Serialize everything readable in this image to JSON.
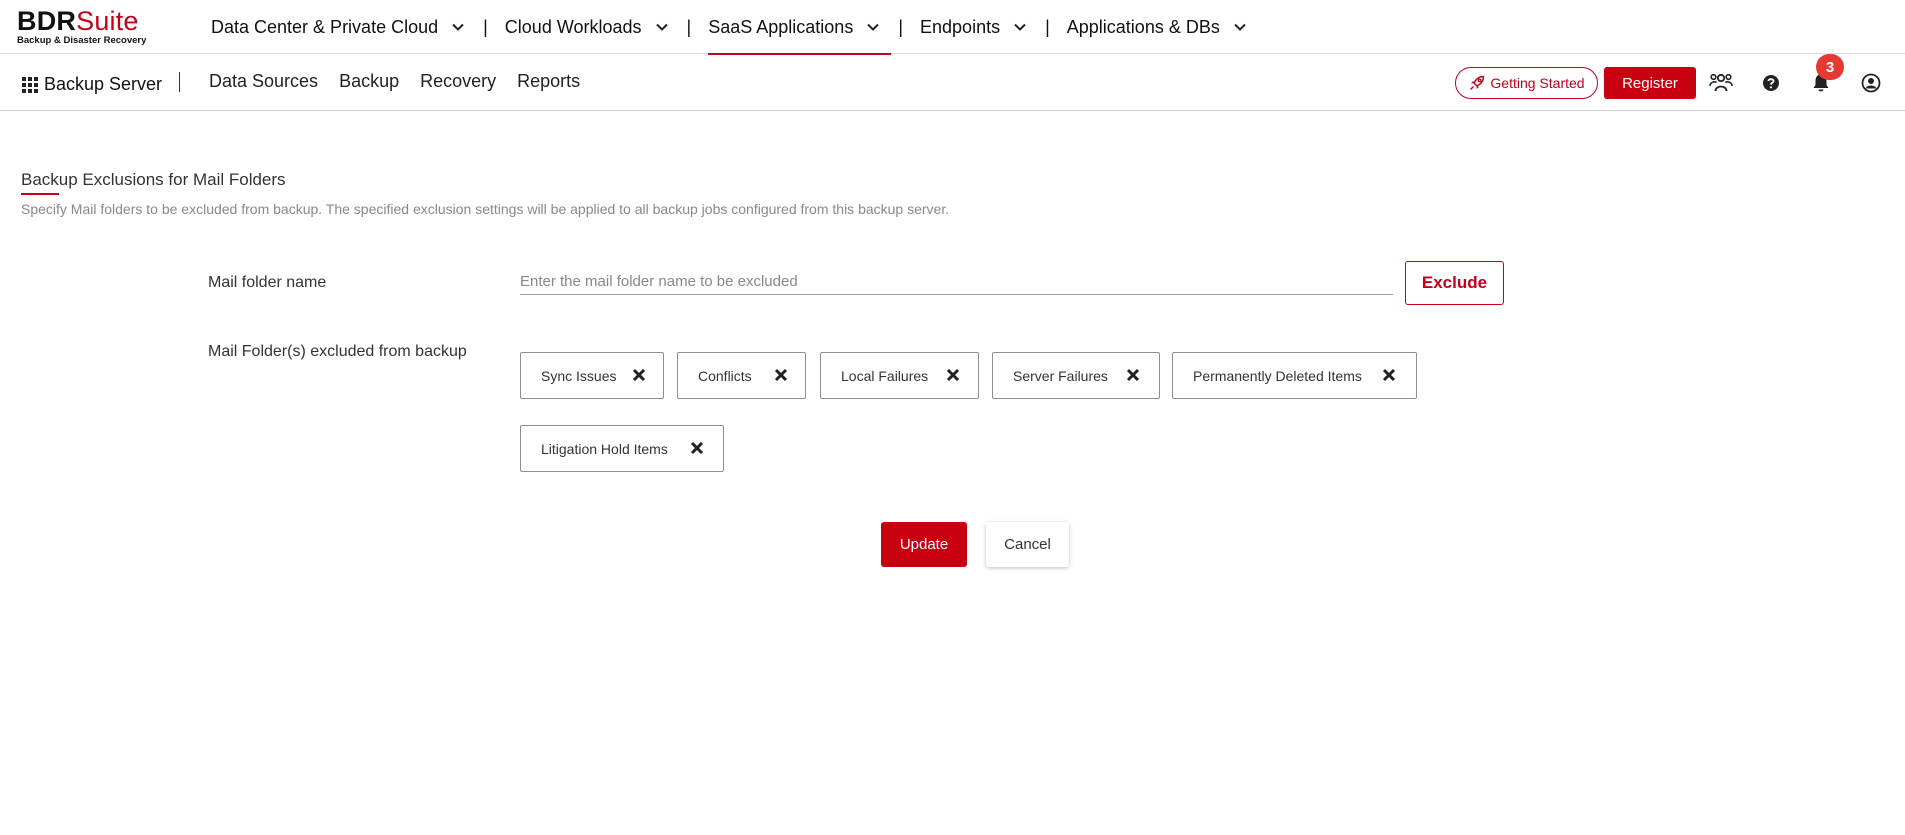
{
  "brand": {
    "name_dark": "BDR",
    "name_red": "Suite",
    "tagline": "Backup & Disaster Recovery",
    "accent_color": "#c4001a"
  },
  "topnav": {
    "items": [
      {
        "label": "Data Center & Private Cloud",
        "icon": "chevron-down-icon"
      },
      {
        "label": "Cloud Workloads",
        "icon": "chevron-down-icon"
      },
      {
        "label": "SaaS Applications",
        "icon": "chevron-down-icon",
        "active": true
      },
      {
        "label": "Endpoints",
        "icon": "chevron-down-icon"
      },
      {
        "label": "Applications & DBs",
        "icon": "chevron-down-icon"
      }
    ],
    "separator": "|"
  },
  "subnav": {
    "apps_icon": "grid-icon",
    "apps_label": "Backup Server",
    "items": [
      {
        "label": "Data Sources"
      },
      {
        "label": "Backup"
      },
      {
        "label": "Recovery"
      },
      {
        "label": "Reports"
      }
    ],
    "getting_started_label": "Getting Started",
    "register_label": "Register",
    "notification_count": "3",
    "icons": [
      "users-icon",
      "help-icon",
      "bell-icon",
      "user-account-icon"
    ]
  },
  "main": {
    "title": "Backup Exclusions for Mail Folders",
    "description": "Specify Mail folders to be excluded from backup. The specified exclusion settings will be applied to all backup jobs configured from this backup server.",
    "mail_folder_label": "Mail folder name",
    "mail_folder_placeholder": "Enter the mail folder name to be excluded",
    "mail_folder_value": "",
    "exclude_label": "Exclude",
    "excluded_label": "Mail Folder(s) excluded from backup",
    "excluded_folders": [
      "Sync Issues",
      "Conflicts",
      "Local Failures",
      "Server Failures",
      "Permanently Deleted Items",
      "Litigation Hold Items"
    ],
    "update_label": "Update",
    "cancel_label": "Cancel"
  }
}
